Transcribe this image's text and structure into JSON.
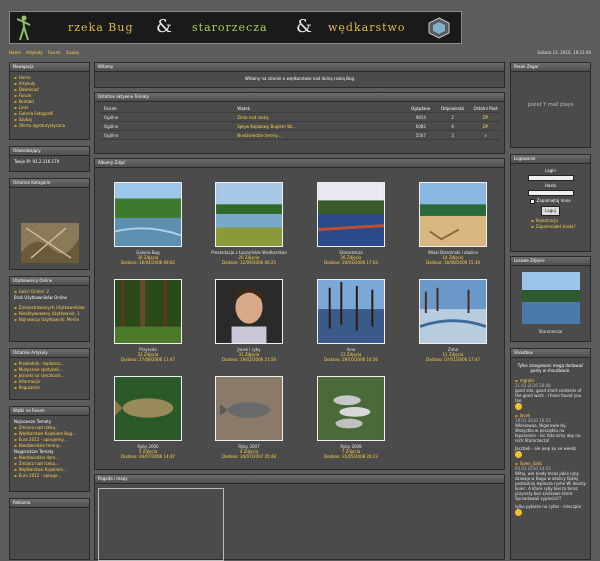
{
  "banner": {
    "part1": "rzeka Bug",
    "amp1": "&",
    "part2": "starorzecza",
    "amp2": "&",
    "part3": "wędkarstwo"
  },
  "nav": {
    "links": [
      "Home",
      "Artykuły",
      "Forum",
      "Szukaj"
    ],
    "date": "Sobota 12, 2010, 18:21:40"
  },
  "left": {
    "nawigacja": {
      "title": "Nawigacja",
      "items": [
        "Home",
        "Artykuły",
        "Download",
        "Forum",
        "Kontakt",
        "Linki",
        "Galeria Fotografii",
        "Szukaj",
        "Oferta agroturystyczna"
      ]
    },
    "odwiedzajacy": {
      "title": "Odwiedzający",
      "text": "Twoje IP: 91.2.116.179"
    },
    "ostatnie": {
      "title": "Ostatnie Kategorie"
    },
    "online": {
      "title": "Użytkownicy Online",
      "lines": [
        "Gości Online: 2",
        "Brak Użytkowników Online",
        "Zarejestrowanych Użytkowników: 18",
        "Nieaktywowany Użytkownik: 1",
        "Najnowszy Użytkownik: Merlin"
      ]
    },
    "artykuly": {
      "title": "Ostatnie Artykuły",
      "items": [
        "Przełodnik - będziesz...",
        "Muzycznie spotykali...",
        "Jeziorki na rzeczkach...",
        "Informacje",
        "Regulamin"
      ]
    },
    "forum": {
      "title": "Wątki na Forum",
      "sub1": "Najnowsze Tematy",
      "items1": [
        "Zmiana nad rzeką...",
        "Wędkarstwo Kajakiem Bug...",
        "Euro 2012 - opisujemy...",
        "Niedźwiedzie tereny..."
      ],
      "sub2": "Najgorętsze Tematy",
      "items2": [
        "Niedźwiedzie dam...",
        "Zmiana nad rzeką...",
        "Wędkarstwo Kajakiem...",
        "Euro 2012 - opisuje..."
      ]
    },
    "reklama": {
      "title": "Reklama"
    }
  },
  "main": {
    "witamy": {
      "title": "Witamy",
      "text": "Witamy na stronie o wędkarstwie nad dolną rzeką Bug"
    },
    "forum": {
      "title": "Ostatnie aktywne Tematy",
      "headers": [
        "Forum",
        "Wątek",
        "Oglądane",
        "Odpowiedzi",
        "Ostatni Post"
      ],
      "rows": [
        [
          "Ogólne",
          "Zima nad rzeką",
          "9854",
          "2",
          "DP"
        ],
        [
          "Ogólne",
          "Spływ Kajakowy Bugiem Wi...",
          "6082",
          "6",
          "DP"
        ],
        [
          "Ogólne",
          "Niedźwiedzie tereny...",
          "5567",
          "3",
          "x"
        ]
      ]
    },
    "gallery": {
      "title": "Albumy Zdjęć",
      "items": [
        {
          "title": "Galeria Bug",
          "count": "30 Zdjęcia",
          "date": "Dodano: 16/04/2006 09:02"
        },
        {
          "title": "Prezentacja z Łączyńskie Wędkarstwo",
          "count": "20 Zdjęcia",
          "date": "Dodano: 12/09/2006 00:25"
        },
        {
          "title": "Starorzecza",
          "count": "26 Zdjęcia",
          "date": "Dodano: 20/03/2006 17:03"
        },
        {
          "title": "Wiaki Brzeziński i okolice",
          "count": "14 Zdjęcia",
          "date": "Dodano: 16/08/2006 15:39"
        },
        {
          "title": "Przyroda",
          "count": "33 Zdjęcia",
          "date": "Dodano: 27/08/2006 11:47"
        },
        {
          "title": "Jacek i ryby",
          "count": "31 Zdjęcia",
          "date": "Dodano: 19/02/2006 21:59"
        },
        {
          "title": "Inne",
          "count": "23 Zdjęcia",
          "date": "Dodano: 29/10/2006 16:56"
        },
        {
          "title": "Zima",
          "count": "11 Zdjęcia",
          "date": "Dodano: 07/01/2006 17:47"
        },
        {
          "title": "Ryby 2006",
          "count": "5 Zdjęcia",
          "date": "Dodano: 04/07/2006 14:47"
        },
        {
          "title": "Ryby 2007",
          "count": "4 Zdjęcia",
          "date": "Dodano: 24/07/2007 20:48"
        },
        {
          "title": "Ryby 2008",
          "count": "7 Zdjęcia",
          "date": "Dodano: 31/05/2008 20:23"
        }
      ]
    },
    "pogoda": {
      "title": "Pogoda i mapy"
    }
  },
  "right": {
    "pixel": {
      "title": "Pasek Zegar",
      "text": "pixlet Y mail plays"
    },
    "login": {
      "title": "Logowanie",
      "login_label": "Login",
      "pass_label": "Hasło",
      "remember": "Zapamiętaj mnie",
      "button": "Loguj",
      "link1": "Rejestracja",
      "link2": "Zapomniałeś hasła?"
    },
    "losowe": {
      "title": "Losowe Zdjęcie",
      "caption": "Starorzecze"
    },
    "shoutbox": {
      "title": "Shoutbox",
      "notice": "Tylko zalogowani mogą dodawać posty w shoutboxie.",
      "posts": [
        {
          "name": "mgrabi",
          "date": "21.01.2010 18:08",
          "text": "good site, good short contents of the good work ..I have found you too"
        },
        {
          "name": "Jacek",
          "date": "18.01.2010 18:53",
          "text": "Wkleiowaa, Nigarowie tej. Wszystko w porządku na łapanienie - nic foto zimy aby na nich Starorzecza!"
        },
        {
          "name": "",
          "date": "",
          "text": "Jaccbek - ale jeep ku ve weedz"
        },
        {
          "name": "Salen_Salic",
          "date": "04.01.2010 14:53",
          "text": "Witaj, wie kiedy teraz jakie ryby dziwaja w Bugu w okolicy Białej podlaskiej lepiesza ryshe Wi doslny lipiec. A ktore ryby bierza teraz przynaty bez zanikowe ktore Sprzedawali zypiecia??"
        },
        {
          "name": "",
          "date": "",
          "text": "tylko pytanie na cyfez - mieczpie"
        }
      ]
    }
  }
}
